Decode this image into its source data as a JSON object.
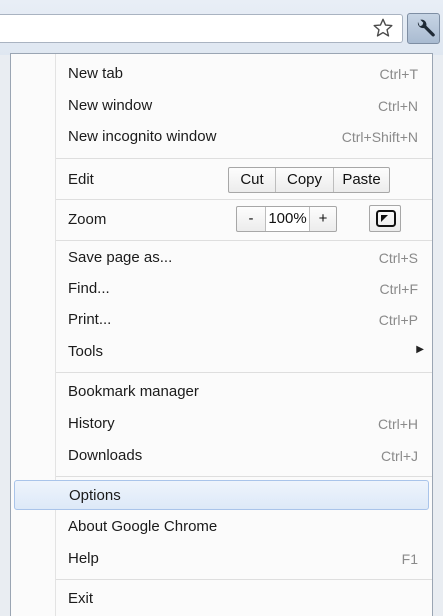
{
  "toolbar": {
    "bookmark_icon": "star-outline-icon",
    "menu_icon": "wrench-icon"
  },
  "menu": {
    "new_tab": {
      "label": "New tab",
      "shortcut": "Ctrl+T"
    },
    "new_window": {
      "label": "New window",
      "shortcut": "Ctrl+N"
    },
    "new_incognito": {
      "label": "New incognito window",
      "shortcut": "Ctrl+Shift+N"
    },
    "edit": {
      "label": "Edit",
      "cut": "Cut",
      "copy": "Copy",
      "paste": "Paste"
    },
    "zoom": {
      "label": "Zoom",
      "minus": "-",
      "value": "100%",
      "plus": "+",
      "fullscreen_icon": "fullscreen-icon"
    },
    "save_page": {
      "label": "Save page as...",
      "shortcut": "Ctrl+S"
    },
    "find": {
      "label": "Find...",
      "shortcut": "Ctrl+F"
    },
    "print": {
      "label": "Print...",
      "shortcut": "Ctrl+P"
    },
    "tools": {
      "label": "Tools",
      "submenu_icon": "submenu-arrow-icon"
    },
    "bookmark_manager": {
      "label": "Bookmark manager"
    },
    "history": {
      "label": "History",
      "shortcut": "Ctrl+H"
    },
    "downloads": {
      "label": "Downloads",
      "shortcut": "Ctrl+J"
    },
    "options": {
      "label": "Options",
      "state": "hovered"
    },
    "about": {
      "label": "About Google Chrome"
    },
    "help": {
      "label": "Help",
      "shortcut": "F1"
    },
    "exit": {
      "label": "Exit"
    }
  }
}
